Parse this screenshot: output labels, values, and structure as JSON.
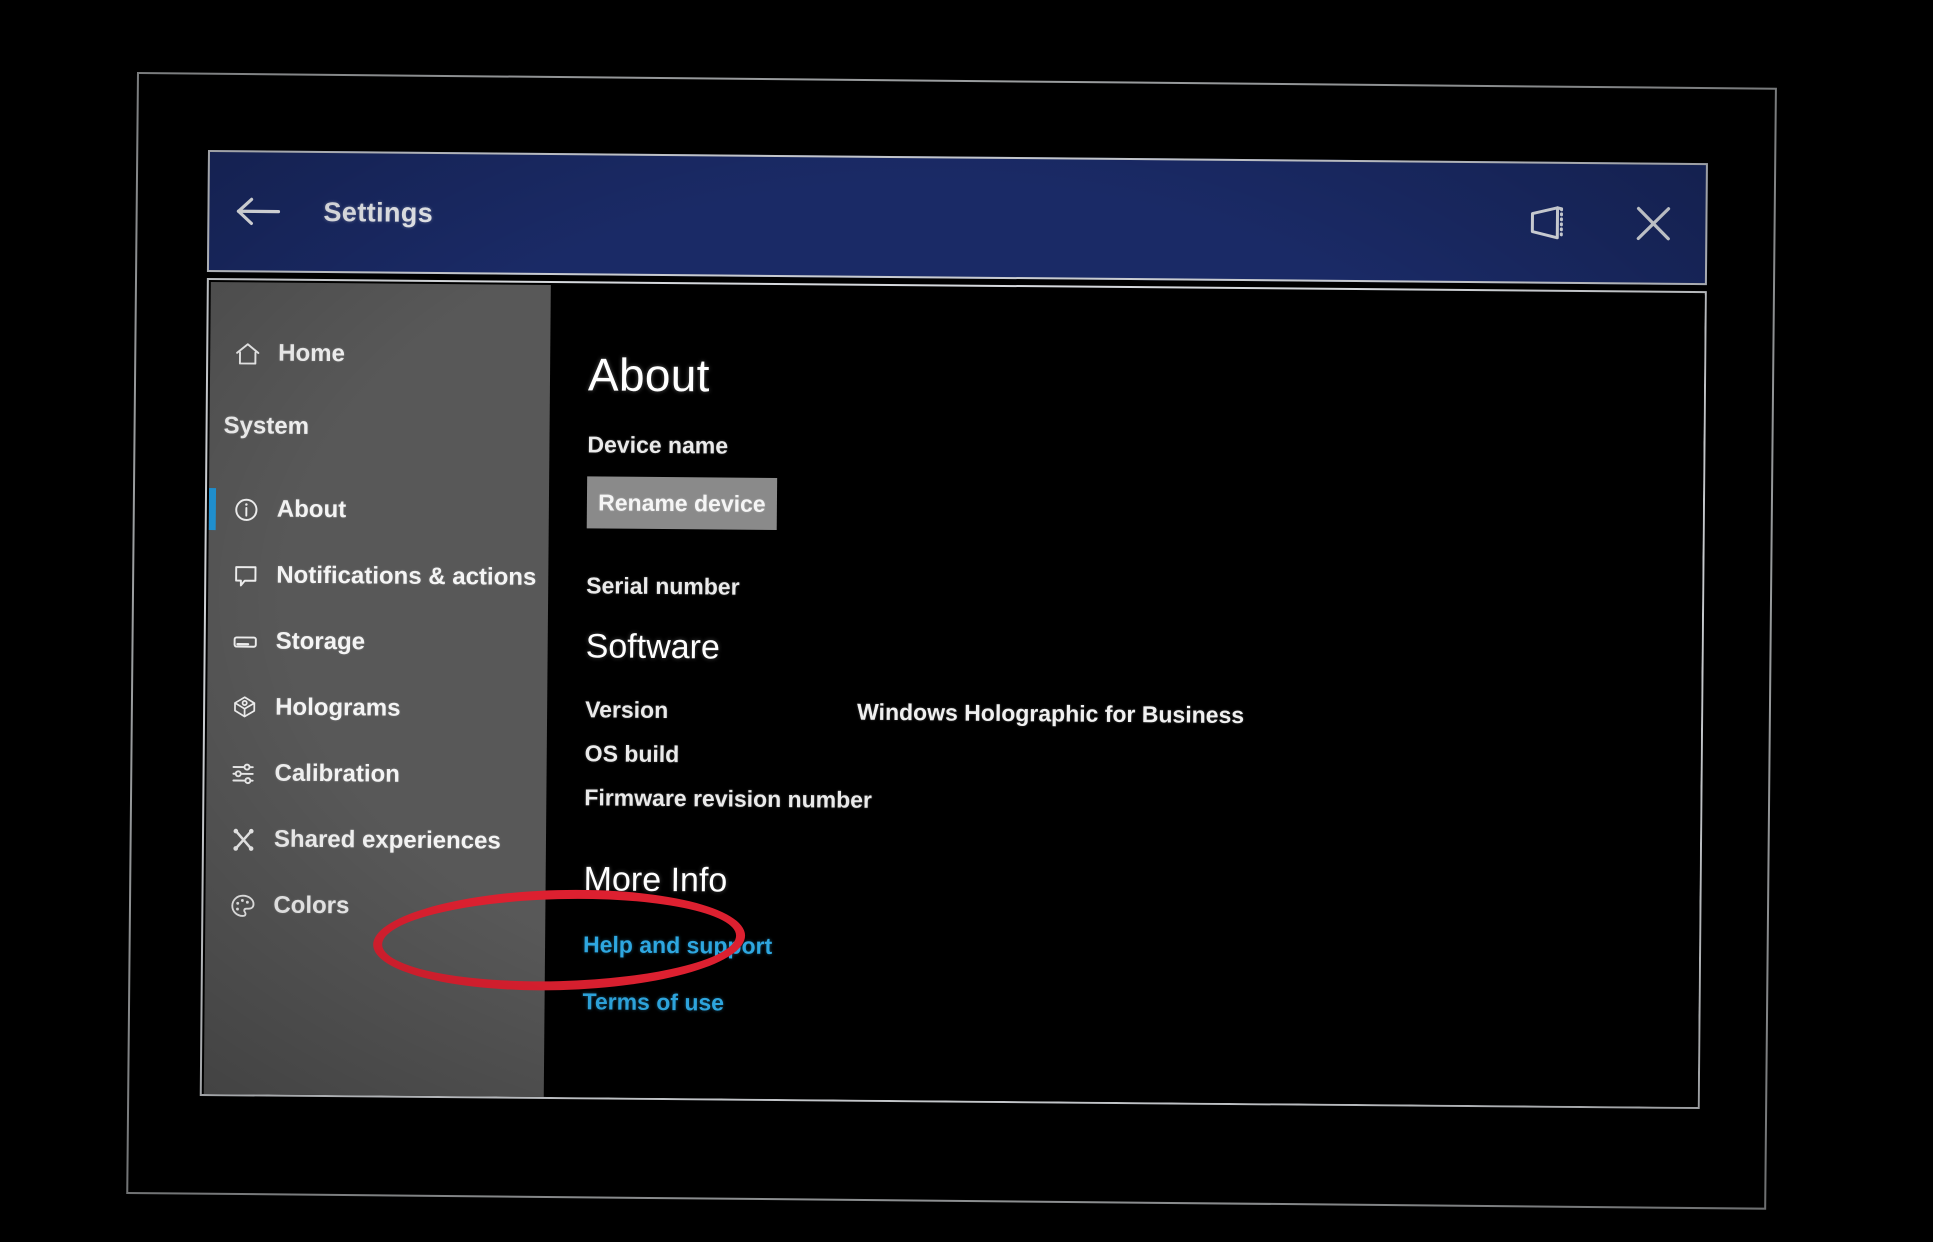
{
  "window": {
    "title": "Settings",
    "back_icon": "back-arrow-icon",
    "follow_me_icon": "follow-me-window-icon",
    "close_icon": "close-icon",
    "titlebar_color": "#1a2a66"
  },
  "sidebar": {
    "background_color": "#585858",
    "accent_color": "#2196d8",
    "group_label": "System",
    "home": {
      "label": "Home",
      "icon": "home-icon"
    },
    "items": [
      {
        "label": "About",
        "icon": "info-icon",
        "selected": true
      },
      {
        "label": "Notifications & actions",
        "icon": "notification-icon",
        "selected": false
      },
      {
        "label": "Storage",
        "icon": "storage-drive-icon",
        "selected": false
      },
      {
        "label": "Holograms",
        "icon": "holograms-icon",
        "selected": false
      },
      {
        "label": "Calibration",
        "icon": "sliders-icon",
        "selected": false
      },
      {
        "label": "Shared experiences",
        "icon": "shared-experiences-icon",
        "selected": false
      },
      {
        "label": "Colors",
        "icon": "color-palette-icon",
        "selected": false
      }
    ]
  },
  "main": {
    "page_title": "About",
    "device_name_label": "Device name",
    "rename_device_label": "Rename device",
    "serial_number_label": "Serial number",
    "software_heading": "Software",
    "version_label": "Version",
    "version_value": "Windows Holographic for Business",
    "os_build_label": "OS build",
    "firmware_label": "Firmware revision number",
    "more_info_heading": "More Info",
    "links": [
      {
        "label": "Help and support"
      },
      {
        "label": "Terms of use"
      }
    ],
    "link_color": "#2ea7e0"
  },
  "annotation": {
    "target": "Storage",
    "shape": "ellipse",
    "color": "#dd2030"
  }
}
